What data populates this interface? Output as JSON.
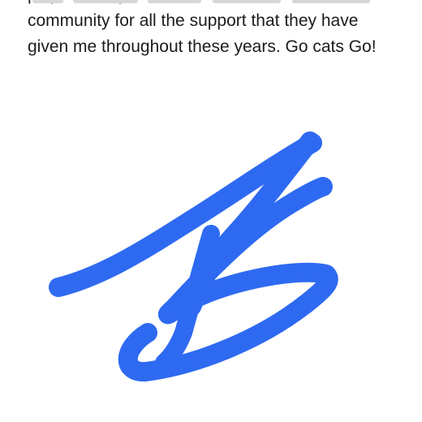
{
  "note": {
    "lines": [
      "",
      "player.  Lastly I would like to thank the bobcat",
      "community for all the support that they have",
      "given me throughout these years. Go cats Go!"
    ]
  },
  "signature": {
    "color": "#1f5ff0",
    "ink": "blue-marker"
  }
}
